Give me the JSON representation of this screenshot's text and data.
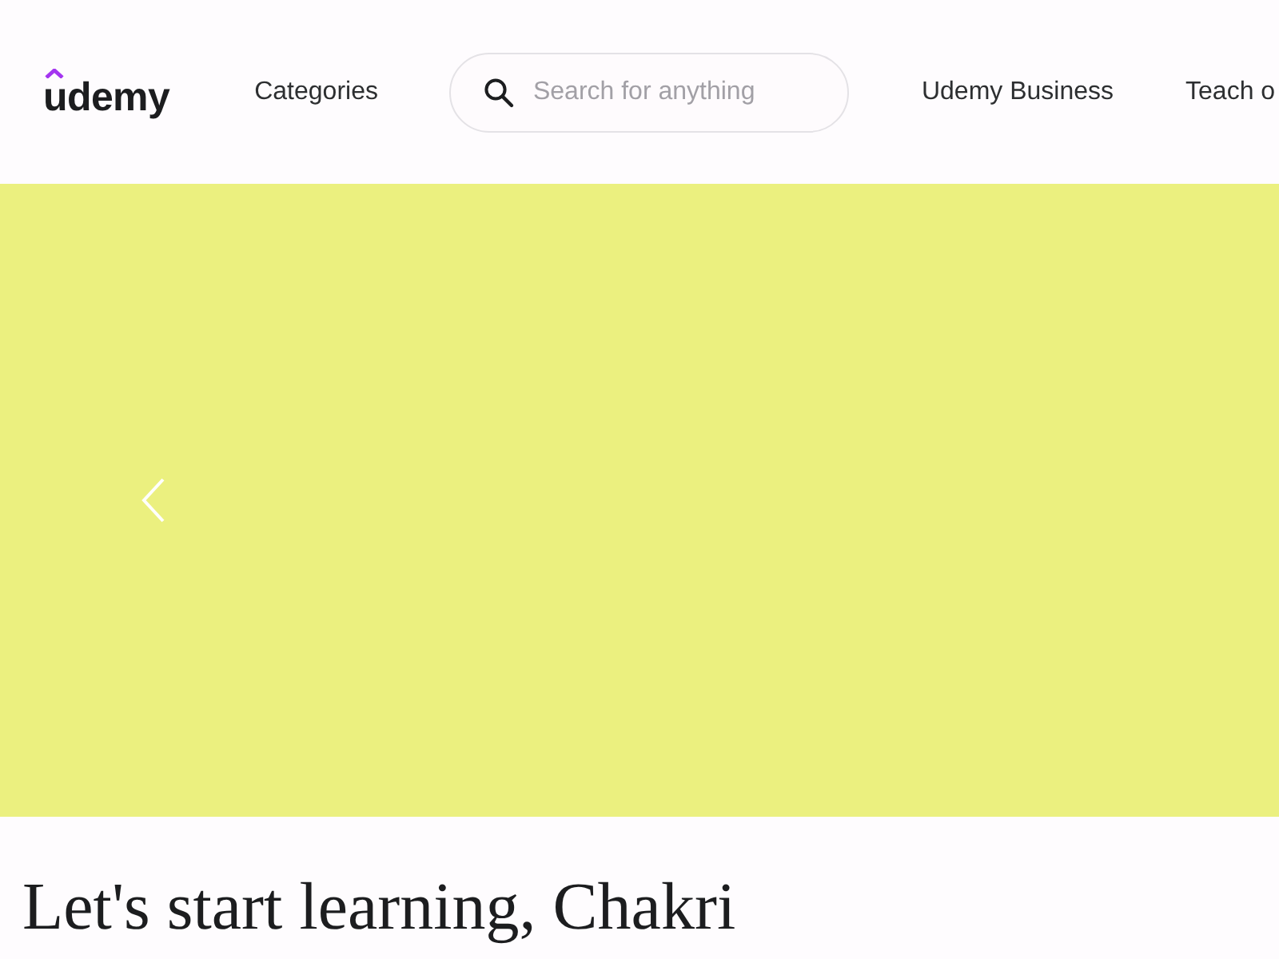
{
  "header": {
    "logo": "udemy",
    "nav_left": [
      {
        "label": "Categories"
      }
    ],
    "search": {
      "placeholder": "Search for anything"
    },
    "nav_right": [
      {
        "label": "Udemy Business"
      },
      {
        "label": "Teach o"
      }
    ]
  },
  "heading": "Let's start learning, Chakri"
}
